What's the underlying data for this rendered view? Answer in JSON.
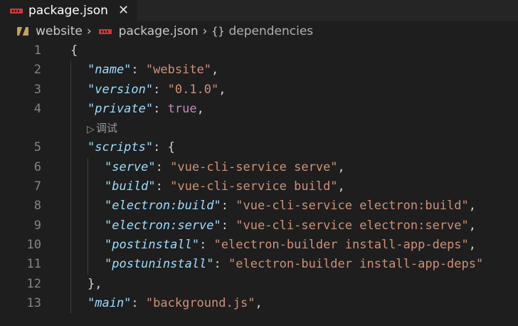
{
  "tab": {
    "label": "package.json"
  },
  "breadcrumb": {
    "folder": "website",
    "file": "package.json",
    "symbol": "dependencies"
  },
  "codelens": "调试",
  "lines": [
    {
      "n": "1",
      "indent": 0,
      "parts": [
        [
          "punc",
          "{"
        ]
      ]
    },
    {
      "n": "2",
      "indent": 1,
      "parts": [
        [
          "key",
          "\"name\""
        ],
        [
          "punc",
          ": "
        ],
        [
          "str",
          "\"website\""
        ],
        [
          "punc",
          ","
        ]
      ]
    },
    {
      "n": "3",
      "indent": 1,
      "parts": [
        [
          "key",
          "\"version\""
        ],
        [
          "punc",
          ": "
        ],
        [
          "str",
          "\"0.1.0\""
        ],
        [
          "punc",
          ","
        ]
      ]
    },
    {
      "n": "4",
      "indent": 1,
      "parts": [
        [
          "key",
          "\"private\""
        ],
        [
          "punc",
          ": "
        ],
        [
          "bool",
          "true"
        ],
        [
          "punc",
          ","
        ]
      ]
    },
    {
      "codelens": true
    },
    {
      "n": "5",
      "indent": 1,
      "parts": [
        [
          "key",
          "\"scripts\""
        ],
        [
          "punc",
          ": {"
        ]
      ]
    },
    {
      "n": "6",
      "indent": 2,
      "parts": [
        [
          "key",
          "\"serve\""
        ],
        [
          "punc",
          ": "
        ],
        [
          "str",
          "\"vue-cli-service serve\""
        ],
        [
          "punc",
          ","
        ]
      ]
    },
    {
      "n": "7",
      "indent": 2,
      "parts": [
        [
          "key",
          "\"build\""
        ],
        [
          "punc",
          ": "
        ],
        [
          "str",
          "\"vue-cli-service build\""
        ],
        [
          "punc",
          ","
        ]
      ]
    },
    {
      "n": "8",
      "indent": 2,
      "parts": [
        [
          "key",
          "\"electron:build\""
        ],
        [
          "punc",
          ": "
        ],
        [
          "str",
          "\"vue-cli-service electron:build\""
        ],
        [
          "punc",
          ","
        ]
      ]
    },
    {
      "n": "9",
      "indent": 2,
      "parts": [
        [
          "key",
          "\"electron:serve\""
        ],
        [
          "punc",
          ": "
        ],
        [
          "str",
          "\"vue-cli-service electron:serve\""
        ],
        [
          "punc",
          ","
        ]
      ]
    },
    {
      "n": "10",
      "indent": 2,
      "parts": [
        [
          "key",
          "\"postinstall\""
        ],
        [
          "punc",
          ": "
        ],
        [
          "str",
          "\"electron-builder install-app-deps\""
        ],
        [
          "punc",
          ","
        ]
      ]
    },
    {
      "n": "11",
      "indent": 2,
      "parts": [
        [
          "key",
          "\"postuninstall\""
        ],
        [
          "punc",
          ": "
        ],
        [
          "str",
          "\"electron-builder install-app-deps\""
        ]
      ]
    },
    {
      "n": "12",
      "indent": 1,
      "parts": [
        [
          "punc",
          "},"
        ]
      ]
    },
    {
      "n": "13",
      "indent": 1,
      "parts": [
        [
          "key",
          "\"main\""
        ],
        [
          "punc",
          ": "
        ],
        [
          "str",
          "\"background.js\""
        ],
        [
          "punc",
          ","
        ]
      ]
    }
  ]
}
